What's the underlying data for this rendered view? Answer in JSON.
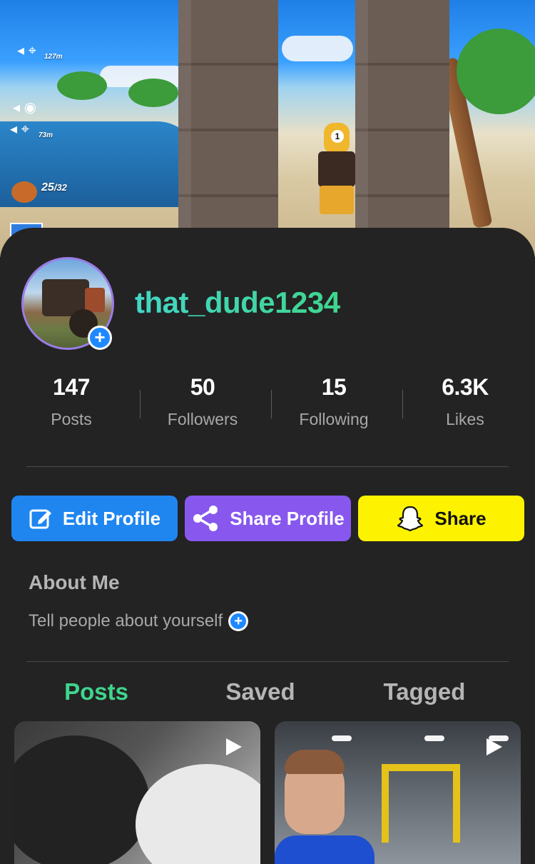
{
  "banner": {
    "hud_distance_1": "127m",
    "hud_distance_2": "73m",
    "hud_counter": "25",
    "hud_counter_total": "/32",
    "player_number": "1"
  },
  "profile": {
    "username": "that_dude1234"
  },
  "stats": [
    {
      "value": "147",
      "label": "Posts"
    },
    {
      "value": "50",
      "label": "Followers"
    },
    {
      "value": "15",
      "label": "Following"
    },
    {
      "value": "6.3K",
      "label": "Likes"
    }
  ],
  "actions": {
    "edit_profile": "Edit Profile",
    "share_profile": "Share Profile",
    "share": "Share"
  },
  "about": {
    "title": "About Me",
    "placeholder": "Tell people about yourself"
  },
  "tabs": [
    {
      "label": "Posts",
      "active": true
    },
    {
      "label": "Saved",
      "active": false
    },
    {
      "label": "Tagged",
      "active": false
    }
  ],
  "colors": {
    "accent_green": "#3fd58c",
    "edit_blue": "#1f86f0",
    "share_purple": "#8757ee",
    "snap_yellow": "#fdf300",
    "background": "#232323"
  },
  "icons": {
    "edit": "edit-square-icon",
    "share_profile": "share-nodes-icon",
    "share": "snapchat-ghost-icon",
    "avatar_add": "plus-circle-icon",
    "about_add": "plus-circle-icon",
    "post_type": "play-icon"
  }
}
